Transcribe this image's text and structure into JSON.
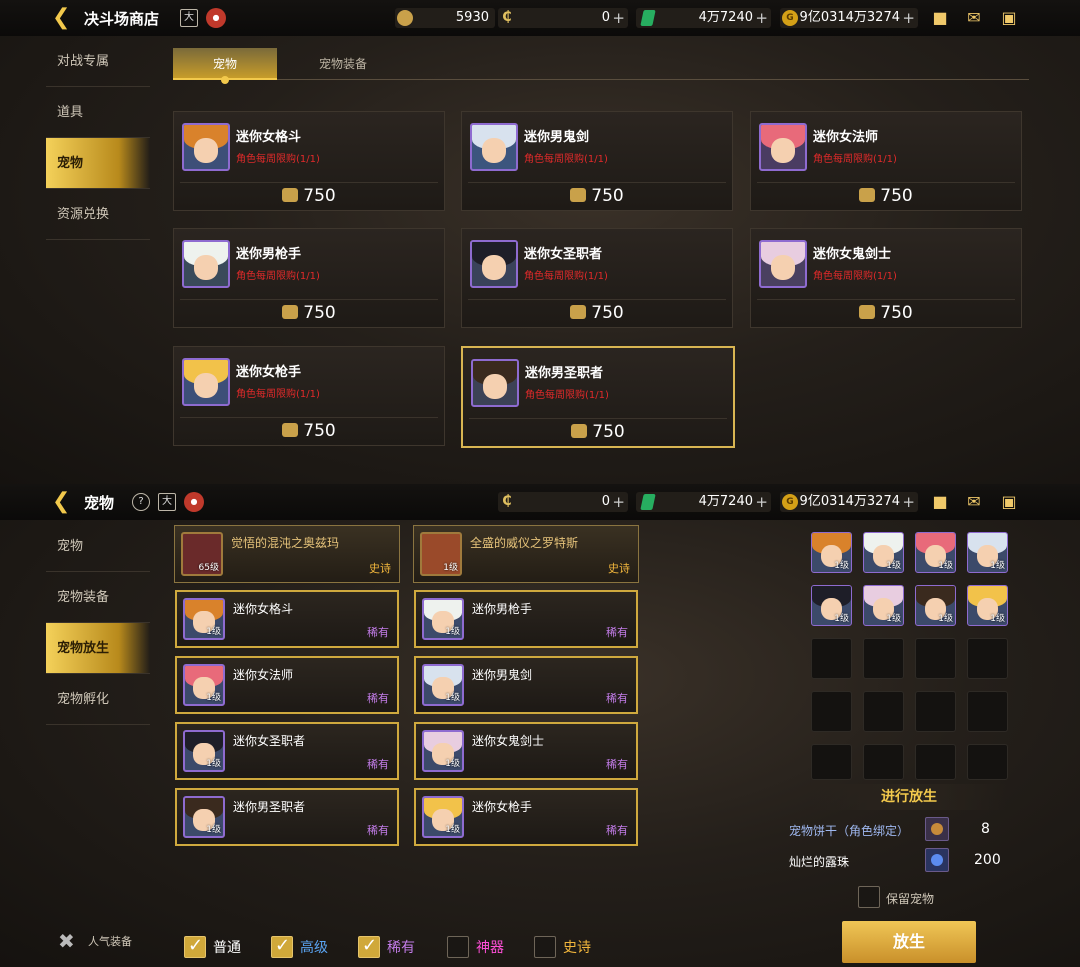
{
  "top1": {
    "title": "决斗场商店",
    "cal_icon": "大",
    "res1": "5930",
    "res2": "0",
    "res3": "4万7240",
    "res4": "9亿0314万3274"
  },
  "shop": {
    "sidebar": [
      "对战专属",
      "道具",
      "宠物",
      "资源兑换"
    ],
    "active_sidebar": 2,
    "tabs": [
      "宠物",
      "宠物装备"
    ],
    "items": [
      {
        "name": "迷你女格斗",
        "limit": "角色每周限购(1/1)",
        "price": "750",
        "hair": "#d9822b",
        "bg": "#3d4f78"
      },
      {
        "name": "迷你男鬼剑",
        "limit": "角色每周限购(1/1)",
        "price": "750",
        "hair": "#d8e2ee",
        "bg": "#3c557e"
      },
      {
        "name": "迷你女法师",
        "limit": "角色每周限购(1/1)",
        "price": "750",
        "hair": "#e86a7a",
        "bg": "#4a3c62"
      },
      {
        "name": "迷你男枪手",
        "limit": "角色每周限购(1/1)",
        "price": "750",
        "hair": "#eef2ee",
        "bg": "#3a4a5a"
      },
      {
        "name": "迷你女圣职者",
        "limit": "角色每周限购(1/1)",
        "price": "750",
        "hair": "#1e1e28",
        "bg": "#39425a"
      },
      {
        "name": "迷你女鬼剑士",
        "limit": "角色每周限购(1/1)",
        "price": "750",
        "hair": "#e8cde0",
        "bg": "#4a4060"
      },
      {
        "name": "迷你女枪手",
        "limit": "角色每周限购(1/1)",
        "price": "750",
        "hair": "#f2c24a",
        "bg": "#3d4f78"
      },
      {
        "name": "迷你男圣职者",
        "limit": "角色每周限购(1/1)",
        "price": "750",
        "hair": "#3a2a1e",
        "bg": "#3c4256"
      }
    ]
  },
  "top2": {
    "title": "宠物",
    "help": "?",
    "cal_icon": "大",
    "res2": "0",
    "res3": "4万7240",
    "res4": "9亿0314万3274"
  },
  "pet": {
    "sidebar": [
      "宠物",
      "宠物装备",
      "宠物放生",
      "宠物孵化"
    ],
    "active_sidebar": 2,
    "featured": [
      {
        "name": "觉悟的混沌之奥兹玛",
        "level": "65级",
        "rarity": "史诗"
      },
      {
        "name": "全盛的威仪之罗特斯",
        "level": "1级",
        "rarity": "史诗"
      }
    ],
    "list": [
      {
        "name": "迷你女格斗",
        "level": "1级",
        "rarity": "稀有",
        "hair": "#d9822b"
      },
      {
        "name": "迷你男枪手",
        "level": "1级",
        "rarity": "稀有",
        "hair": "#eef2ee"
      },
      {
        "name": "迷你女法师",
        "level": "1级",
        "rarity": "稀有",
        "hair": "#e86a7a"
      },
      {
        "name": "迷你男鬼剑",
        "level": "1级",
        "rarity": "稀有",
        "hair": "#d8e2ee"
      },
      {
        "name": "迷你女圣职者",
        "level": "1级",
        "rarity": "稀有",
        "hair": "#1e1e28"
      },
      {
        "name": "迷你女鬼剑士",
        "level": "1级",
        "rarity": "稀有",
        "hair": "#e8cde0"
      },
      {
        "name": "迷你男圣职者",
        "level": "1级",
        "rarity": "稀有",
        "hair": "#3a2a1e"
      },
      {
        "name": "迷你女枪手",
        "level": "1级",
        "rarity": "稀有",
        "hair": "#f2c24a"
      }
    ],
    "slots": [
      {
        "level": "1级",
        "hair": "#d9822b"
      },
      {
        "level": "1级",
        "hair": "#eef2ee"
      },
      {
        "level": "1级",
        "hair": "#e86a7a"
      },
      {
        "level": "1级",
        "hair": "#d8e2ee"
      },
      {
        "level": "1级",
        "hair": "#1e1e28"
      },
      {
        "level": "1级",
        "hair": "#e8cde0"
      },
      {
        "level": "1级",
        "hair": "#3a2a1e"
      },
      {
        "level": "1级",
        "hair": "#f2c24a"
      }
    ],
    "release_header": "进行放生",
    "reward1_label": "宠物饼干（角色绑定）",
    "reward1_value": "8",
    "reward2_label": "灿烂的露珠",
    "reward2_value": "200",
    "keep_label": "保留宠物",
    "release_button": "放生",
    "popular_label": "人气装备",
    "filters": [
      {
        "label": "普通",
        "checked": true,
        "color": "#ffffff"
      },
      {
        "label": "高级",
        "checked": true,
        "color": "#5aa3f0"
      },
      {
        "label": "稀有",
        "checked": true,
        "color": "#c27ce8"
      },
      {
        "label": "神器",
        "checked": false,
        "color": "#ff4fd8"
      },
      {
        "label": "史诗",
        "checked": false,
        "color": "#f2b63c"
      }
    ]
  }
}
